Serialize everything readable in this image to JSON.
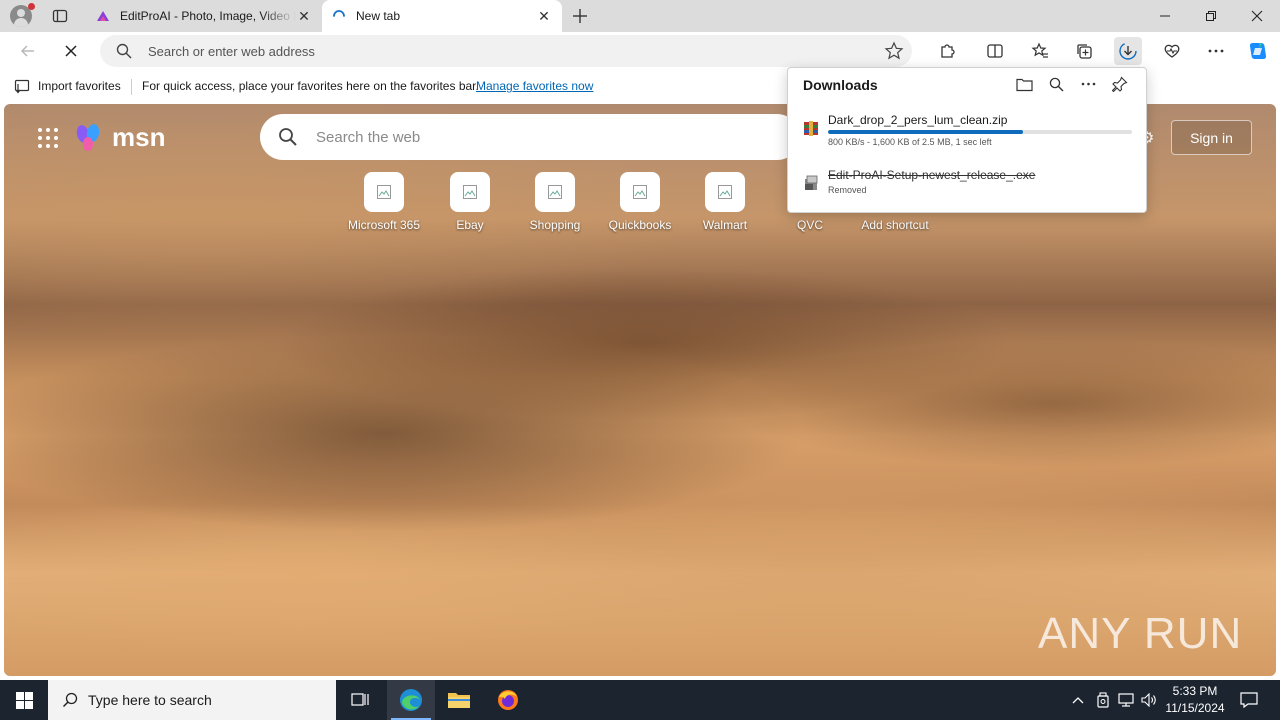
{
  "browser": {
    "tabs": [
      {
        "title": "EditProAI - Photo, Image, Video E",
        "active": false
      },
      {
        "title": "New tab",
        "active": true
      }
    ],
    "address_placeholder": "Search or enter web address"
  },
  "favorites_bar": {
    "import_label": "Import favorites",
    "message": "For quick access, place your favorites here on the favorites bar.",
    "link": "Manage favorites now"
  },
  "msn": {
    "logo_text": "msn",
    "search_placeholder": "Search the web",
    "sign_in": "Sign in",
    "shortcuts": [
      {
        "label": "Microsoft 365"
      },
      {
        "label": "Ebay"
      },
      {
        "label": "Shopping"
      },
      {
        "label": "Quickbooks"
      },
      {
        "label": "Walmart"
      },
      {
        "label": "QVC"
      },
      {
        "label": "Add shortcut"
      }
    ]
  },
  "downloads": {
    "title": "Downloads",
    "items": [
      {
        "name": "Dark_drop_2_pers_lum_clean.zip",
        "status": "800 KB/s - 1,600 KB of 2.5 MB, 1 sec left",
        "progress": 0.64
      },
      {
        "name": "Edit-ProAI-Setup-newest_release_.exe",
        "status": "Removed"
      }
    ]
  },
  "watermark": "ANY RUN",
  "taskbar": {
    "search_placeholder": "Type here to search",
    "time": "5:33 PM",
    "date": "11/15/2024"
  },
  "colors": {
    "accent": "#0f6cbd",
    "taskbar": "#1c2430",
    "tabstrip": "#dcdcdc"
  }
}
